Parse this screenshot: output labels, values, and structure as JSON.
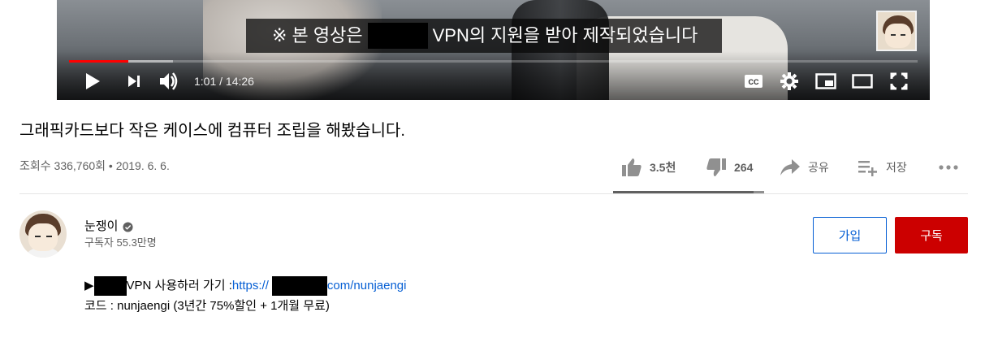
{
  "player": {
    "subtitle_prefix": "※ 본 영상은",
    "subtitle_suffix": "VPN의 지원을 받아 제작되었습니다",
    "time_display": "1:01 / 14:26",
    "progress_played_fraction": 0.0702,
    "progress_buffered_fraction": 0.1225,
    "icons": [
      "play-icon",
      "next-icon",
      "volume-icon",
      "captions-icon",
      "settings-icon",
      "miniplayer-icon",
      "theater-icon",
      "fullscreen-icon"
    ]
  },
  "video": {
    "title": "그래픽카드보다 작은 케이스에 컴퓨터 조립을 해봤습니다.",
    "meta": "조회수 336,760회 • 2019. 6. 6."
  },
  "actions": {
    "like_count": "3.5천",
    "dislike_count": "264",
    "share_label": "공유",
    "save_label": "저장",
    "like_fraction": 0.93
  },
  "channel": {
    "name": "눈쟁이",
    "subscribers": "구독자 55.3만명",
    "join_label": "가입",
    "subscribe_label": "구독"
  },
  "description": {
    "line1_arrow": "▶",
    "line1_text": "VPN 사용하러 가기 : ",
    "line1_link_prefix": "https://",
    "line1_link_suffix": "com/nunjaengi",
    "line2": "코드 : nunjaengi (3년간 75%할인 + 1개월 무료)"
  },
  "colors": {
    "progress_red": "#ff0000",
    "subscribe_red": "#cc0000",
    "link_blue": "#065fd4",
    "meta_gray": "#606060"
  }
}
